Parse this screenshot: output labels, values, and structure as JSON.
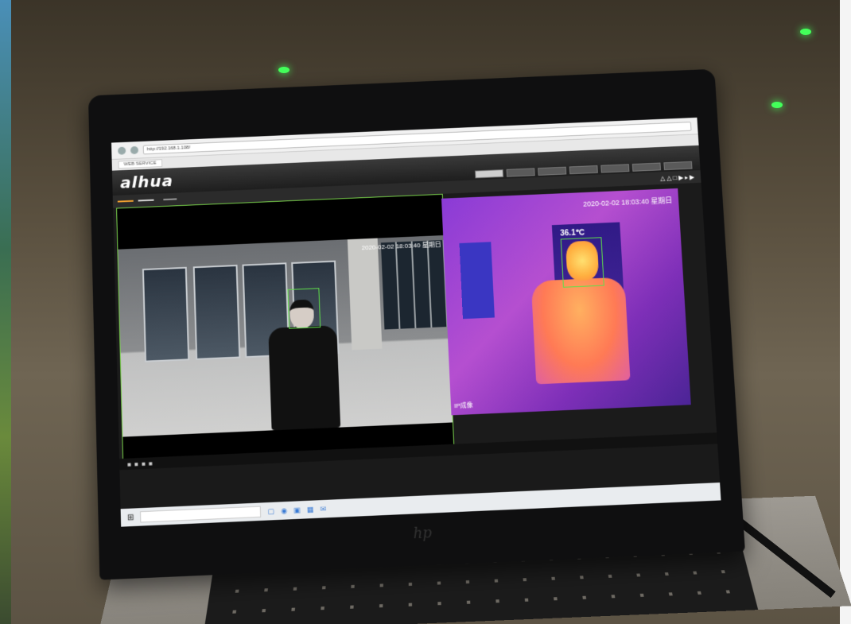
{
  "browser": {
    "url": "http://192.168.1.108/",
    "tab_label": "WEB SERVICE"
  },
  "app": {
    "logo_text": "alhua",
    "top_nav": [
      "",
      "",
      "",
      "",
      "",
      "",
      ""
    ],
    "toolbar_buttons": [
      "",
      ""
    ],
    "stream_select_label": "",
    "stream_select_value": ""
  },
  "visible_view": {
    "timestamp": "2020-02-02 18:03:40 星期日",
    "footer": ""
  },
  "thermal_view": {
    "timestamp": "2020-02-02 18:03:40 星期日",
    "temperature": "36.1℃",
    "footer": "IP成像"
  },
  "taskbar": {
    "search_placeholder": ""
  },
  "brand": {
    "laptop_logo": "hp"
  },
  "colors": {
    "face_box": "#5fe04a",
    "accent_button": "#f0a030",
    "ceiling_indicator": "#43ff5a"
  }
}
